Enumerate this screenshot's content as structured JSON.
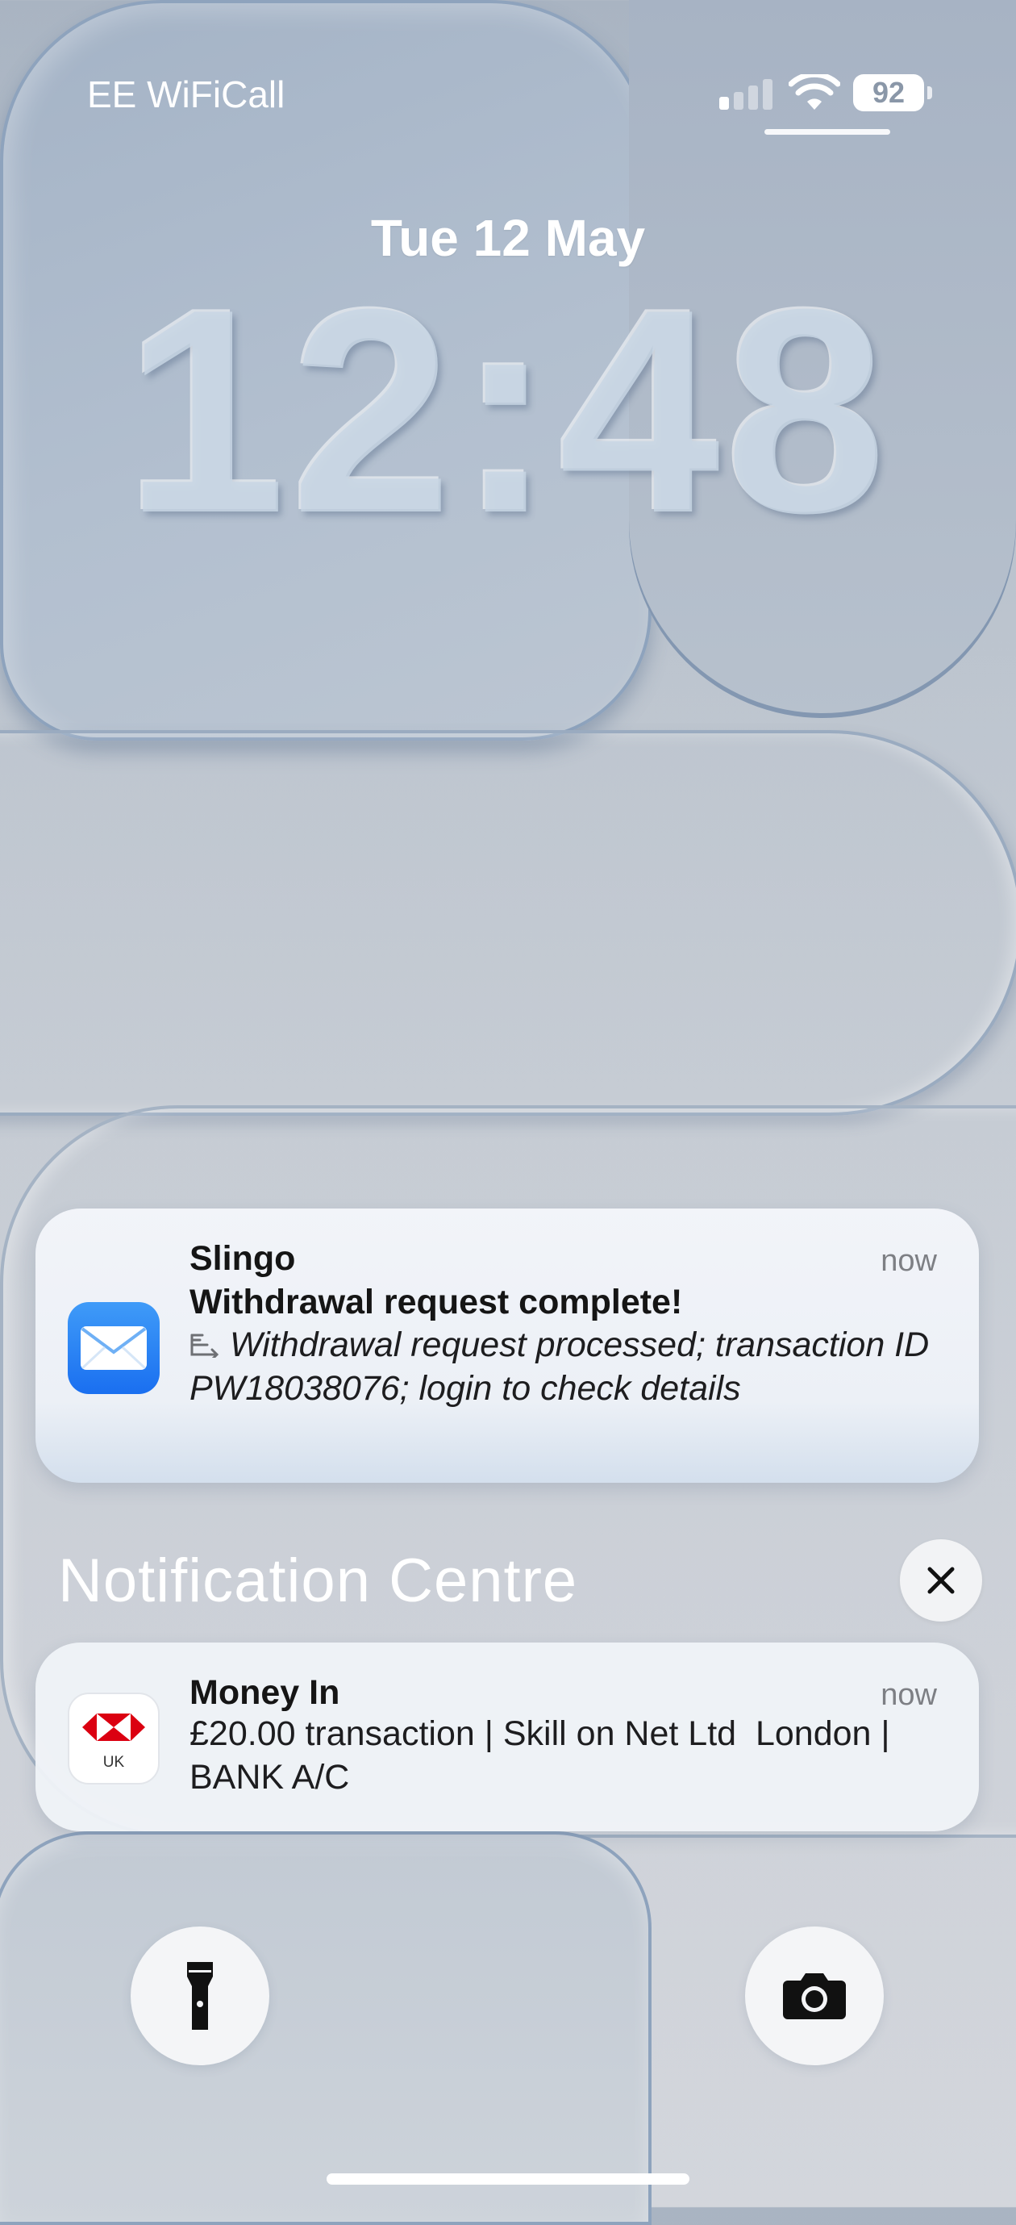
{
  "status_bar": {
    "carrier": "EE WiFiCall",
    "battery_level": "92",
    "signal_bars_active": 1,
    "signal_bars_total": 4
  },
  "lock_screen": {
    "date": "Tue 12 May",
    "time": "12:48"
  },
  "notifications": [
    {
      "app": "Slingo",
      "time": "now",
      "title": "Withdrawal request complete!",
      "body": "Withdrawal request processed; transaction ID PW18038076; login to check details",
      "icon": "mail-icon"
    }
  ],
  "notification_centre": {
    "heading": "Notification Centre",
    "items": [
      {
        "app": "Money In",
        "time": "now",
        "body": "£20.00 transaction | Skill on Net Ltd  London | BANK A/C",
        "icon": "hsbc-icon",
        "icon_label": "UK"
      }
    ]
  },
  "controls": {
    "left": "flashlight-icon",
    "right": "camera-icon"
  },
  "colors": {
    "hsbc_red": "#db0011",
    "mail_blue": "#1a6ff0"
  }
}
